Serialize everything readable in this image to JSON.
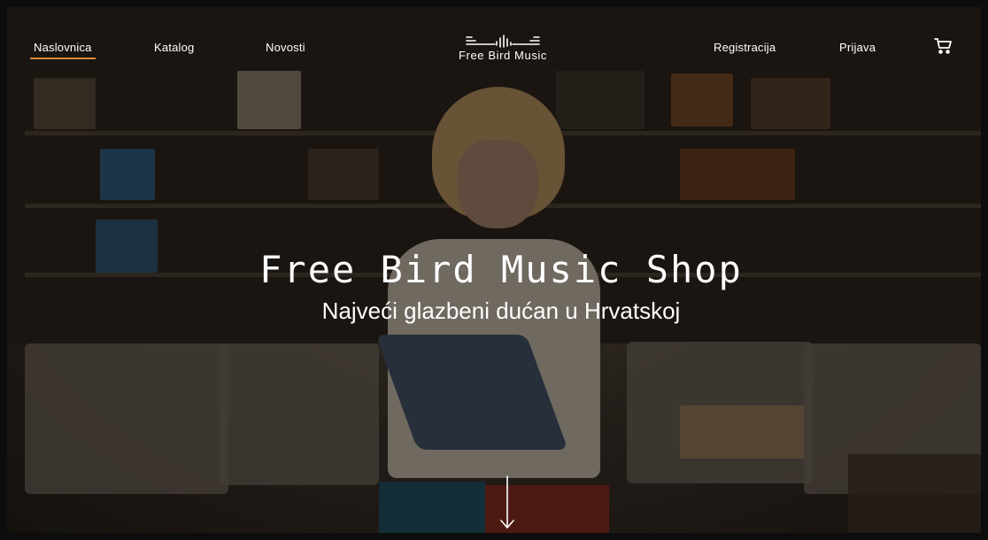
{
  "nav": {
    "left": [
      "Naslovnica",
      "Katalog",
      "Novosti"
    ],
    "active": "Naslovnica",
    "right": [
      "Registracija",
      "Prijava"
    ],
    "cart_icon": "cart-icon"
  },
  "logo": {
    "text": "Free Bird Music",
    "icon": "sound-wave-icon"
  },
  "hero": {
    "title": "Free Bird Music Shop",
    "subtitle": "Najveći glazbeni dućan u Hrvatskoj",
    "scroll_icon": "arrow-down-icon"
  },
  "colors": {
    "accent": "#d98a3a",
    "text": "#ffffff"
  }
}
